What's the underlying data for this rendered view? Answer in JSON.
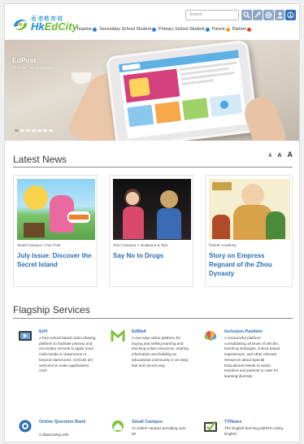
{
  "header": {
    "logo_cn": "香港教育城",
    "logo_en_a": "Hk",
    "logo_en_b": "EdCity",
    "search_placeholder": "Search",
    "nav": [
      {
        "label": "Teacher",
        "color": "#2c7bc9"
      },
      {
        "label": "Secondary School Student",
        "color": "#2c7bc9"
      },
      {
        "label": "Primary School Student",
        "color": "#2c7bc9"
      },
      {
        "label": "Parent",
        "color": "#e8a21c"
      },
      {
        "label": "Partner",
        "color": "#d9442b"
      }
    ]
  },
  "hero": {
    "title": "EdPost",
    "subtitle": "Outside The Classroom",
    "pager_count": 7,
    "pager_active": 0
  },
  "latest_news": {
    "title": "Latest News",
    "font_small": "A",
    "font_medium": "A",
    "font_large": "A",
    "items": [
      {
        "category": "Small Campus > Fun Post",
        "title": "July Issue: Discover the Secret Island"
      },
      {
        "category": "Teen Campus > Guidance & Tips",
        "title": "Say No to Drugs"
      },
      {
        "category": "Parent Academy",
        "title": "Story on Empress Regnant of the Zhou Dynasty"
      }
    ]
  },
  "flagship": {
    "title": "Flagship Services",
    "items": [
      {
        "name": "EdV",
        "desc": "A free school-based video-sharing platform to facilitate primary and secondary schools to apply more multi-media in classrooms or beyond classrooms. Schools are welcome to make applications now!",
        "icon": "edv-icon"
      },
      {
        "name": "EdMall",
        "desc": "A one-stop online platform for buying and selling learning and teaching online resources, sharing information and building an educational community in an easy, fast and secure way.",
        "icon": "edmall-icon"
      },
      {
        "name": "Inclusion Pavilion",
        "desc": "A resourceful platform consolidating all kinds of articles, teaching strategies, school based experiences, and other relevant resources about Special Educational Needs to assist teachers and parents to cater for learning diversity",
        "icon": "inclusion-pavilion-icon"
      },
      {
        "name": "Online Question Bank",
        "desc": "Collaborating with",
        "icon": "question-bank-icon"
      },
      {
        "name": "Small Campus",
        "desc": "An online campus providing over 50",
        "icon": "small-campus-icon"
      },
      {
        "name": "TVNews",
        "desc": "The English learning platform using English",
        "icon": "tvnews-icon"
      }
    ]
  }
}
